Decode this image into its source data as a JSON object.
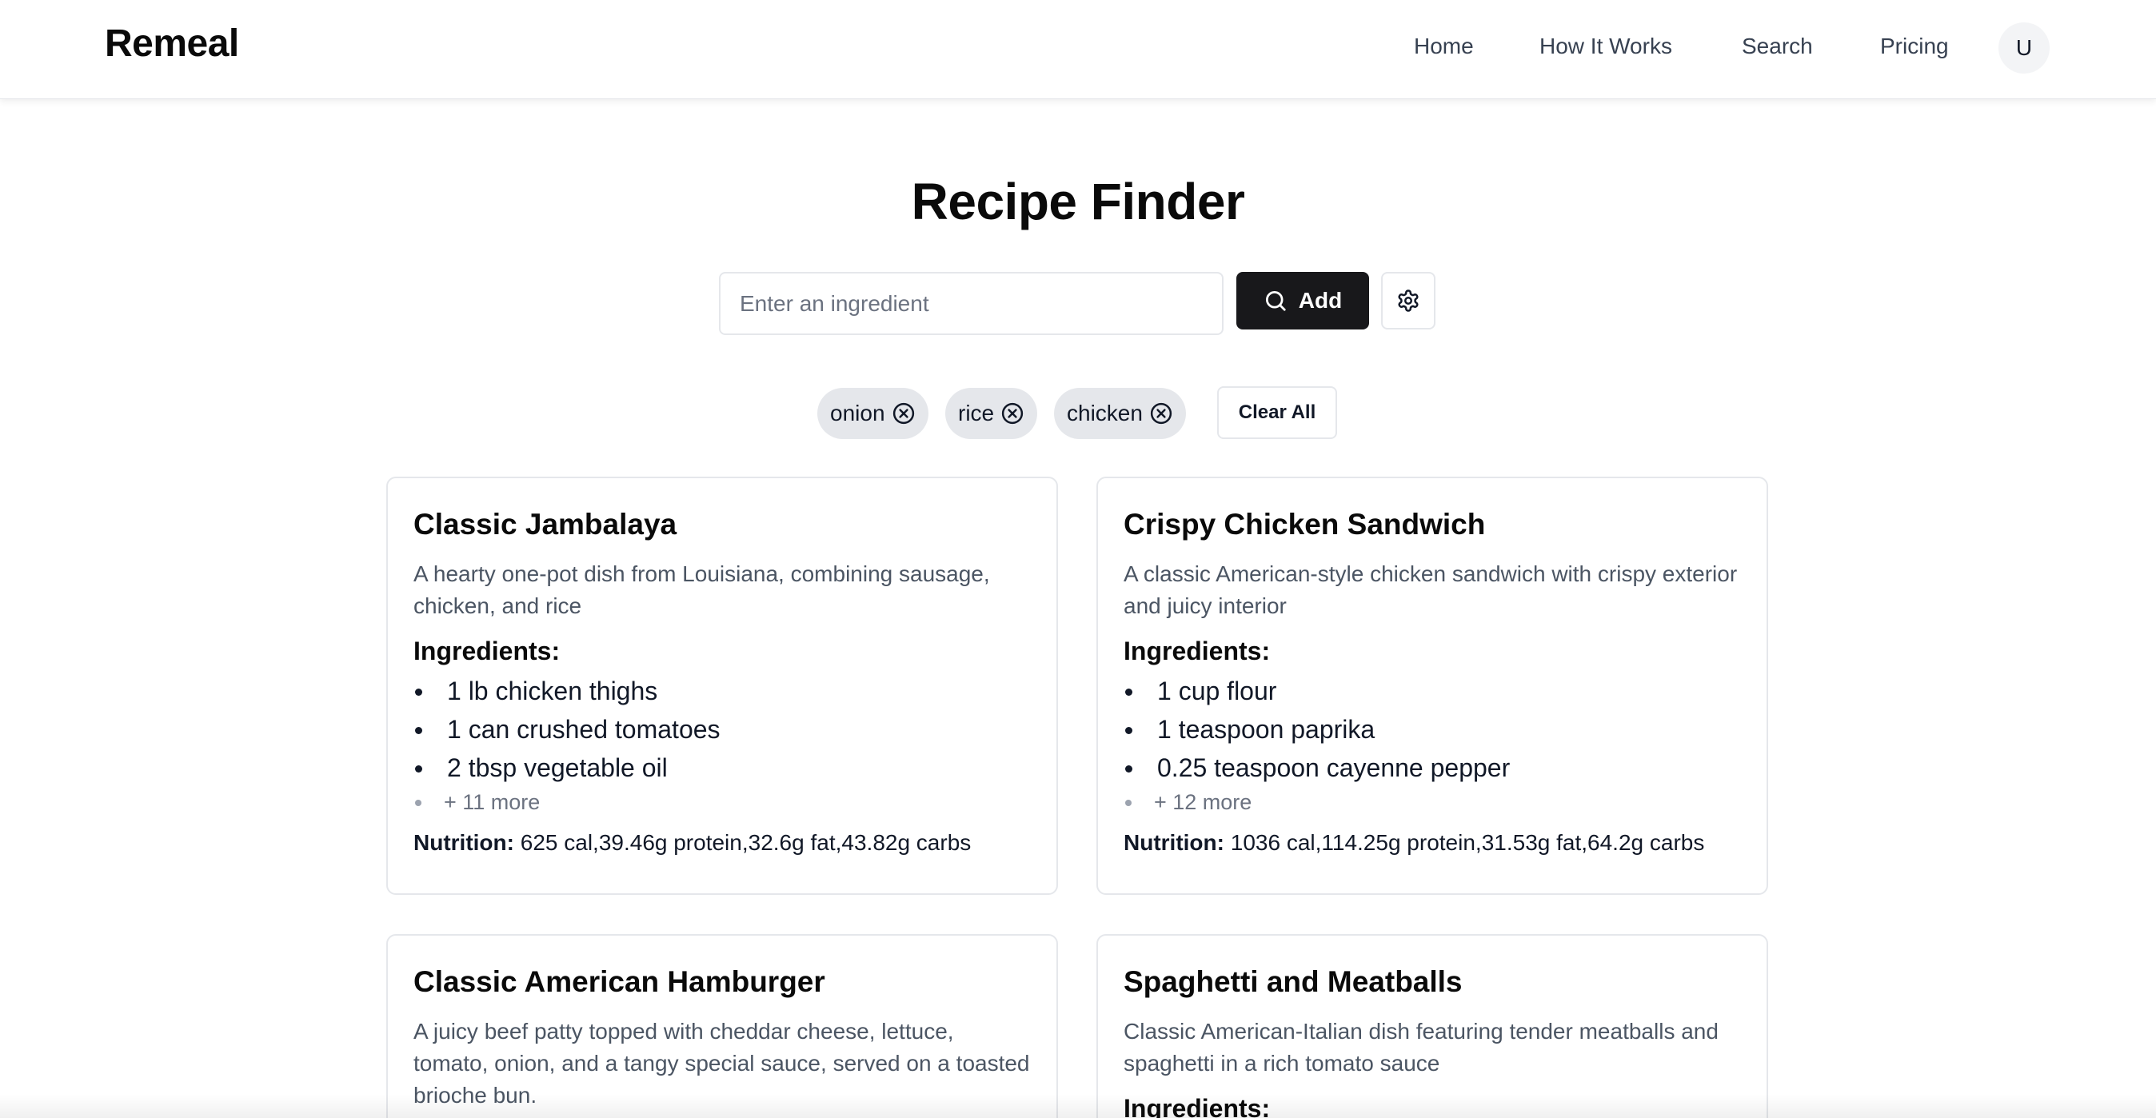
{
  "header": {
    "brand": "Remeal",
    "nav": [
      "Home",
      "How It Works",
      "Search",
      "Pricing"
    ],
    "avatar_initial": "U"
  },
  "main": {
    "title": "Recipe Finder",
    "search": {
      "placeholder": "Enter an ingredient",
      "value": ""
    },
    "add_label": "Add",
    "icons": {
      "add": "search-icon",
      "settings": "gear-icon",
      "chip_remove": "close-circle-icon"
    },
    "chips": [
      "onion",
      "rice",
      "chicken"
    ],
    "clear_all": "Clear All",
    "ingredients_heading": "Ingredients:",
    "nutrition_label": "Nutrition:"
  },
  "recipes": [
    {
      "title": "Classic Jambalaya",
      "description": "A hearty one-pot dish from Louisiana, combining sausage, chicken, and rice",
      "ingredients": [
        "1 lb chicken thighs",
        "1 can crushed tomatoes",
        "2 tbsp vegetable oil"
      ],
      "more": "+ 11 more",
      "nutrition": "625 cal,39.46g protein,32.6g fat,43.82g carbs"
    },
    {
      "title": "Crispy Chicken Sandwich",
      "description": "A classic American-style chicken sandwich with crispy exterior and juicy interior",
      "ingredients": [
        "1 cup flour",
        "1 teaspoon paprika",
        "0.25 teaspoon cayenne pepper"
      ],
      "more": "+ 12 more",
      "nutrition": "1036 cal,114.25g protein,31.53g fat,64.2g carbs"
    },
    {
      "title": "Classic American Hamburger",
      "description": "A juicy beef patty topped with cheddar cheese, lettuce, tomato, onion, and a tangy special sauce, served on a toasted brioche bun."
    },
    {
      "title": "Spaghetti and Meatballs",
      "description": "Classic American-Italian dish featuring tender meatballs and spaghetti in a rich tomato sauce"
    }
  ],
  "colors": {
    "primary": "#18181b",
    "chip_bg": "#e5e7eb",
    "muted_text": "#4b5563",
    "border": "#e5e7eb"
  }
}
